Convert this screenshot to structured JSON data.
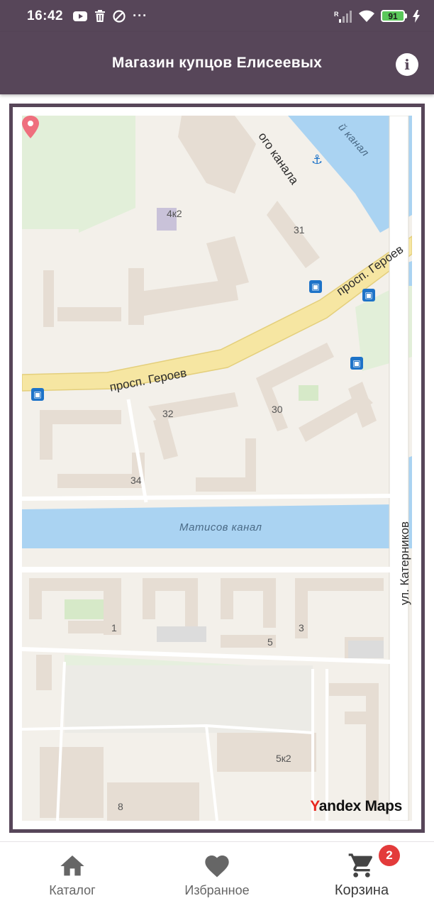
{
  "status_bar": {
    "time": "16:42",
    "battery": "91",
    "signal_label": "R"
  },
  "app_bar": {
    "title": "Магазин купцов Елисеевых",
    "info_icon": "info-icon"
  },
  "map": {
    "streets": {
      "prospekt_top": "просп. Героев",
      "prospekt_bottom": "просп. Героев",
      "katernikov": "ул. Катерников",
      "kanal_top": "ого канала",
      "kanal_right": "й канал"
    },
    "water": {
      "matisov": "Матисов канал"
    },
    "houses": {
      "h4k2": "4к2",
      "h31": "31",
      "h32": "32",
      "h30": "30",
      "h34": "34",
      "h1": "1",
      "h5": "5",
      "h3": "3",
      "h5k2": "5к2",
      "h8": "8"
    },
    "attribution": {
      "y": "Y",
      "rest": "andex Maps"
    },
    "colors": {
      "water": "#aad3f2",
      "road_major": "#f6e6a2",
      "green": "#e2efd9",
      "building": "#e6ddd3"
    }
  },
  "bottom_nav": {
    "items": [
      {
        "label": "Каталог",
        "icon": "home-icon"
      },
      {
        "label": "Избранное",
        "icon": "heart-icon"
      },
      {
        "label": "Корзина",
        "icon": "cart-icon",
        "badge": "2"
      }
    ]
  },
  "colors": {
    "primary": "#574659",
    "badge": "#e33b3b"
  }
}
